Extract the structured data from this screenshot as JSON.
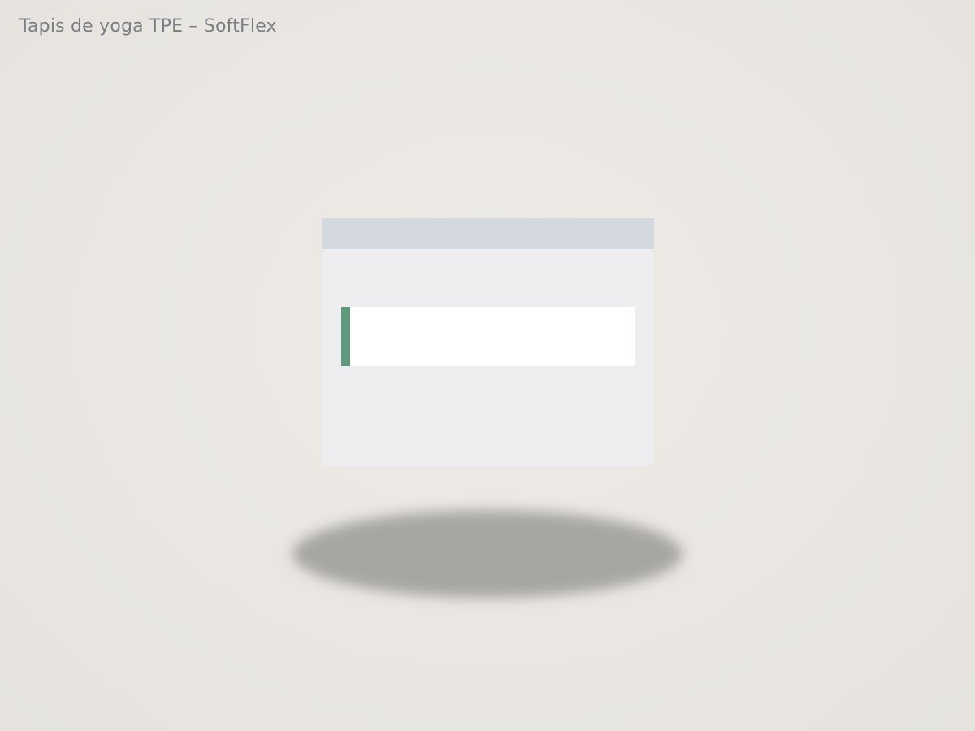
{
  "page": {
    "title": "Tapis de yoga TPE – SoftFlex"
  },
  "colors": {
    "background": "#ebe8e4",
    "card": "#eeeef0",
    "card_header": "#d4d8df",
    "mat_body": "#ffffff",
    "mat_accent": "#5f9a7f",
    "shadow": "#a8a6a2",
    "title_text": "#7a7e84"
  }
}
